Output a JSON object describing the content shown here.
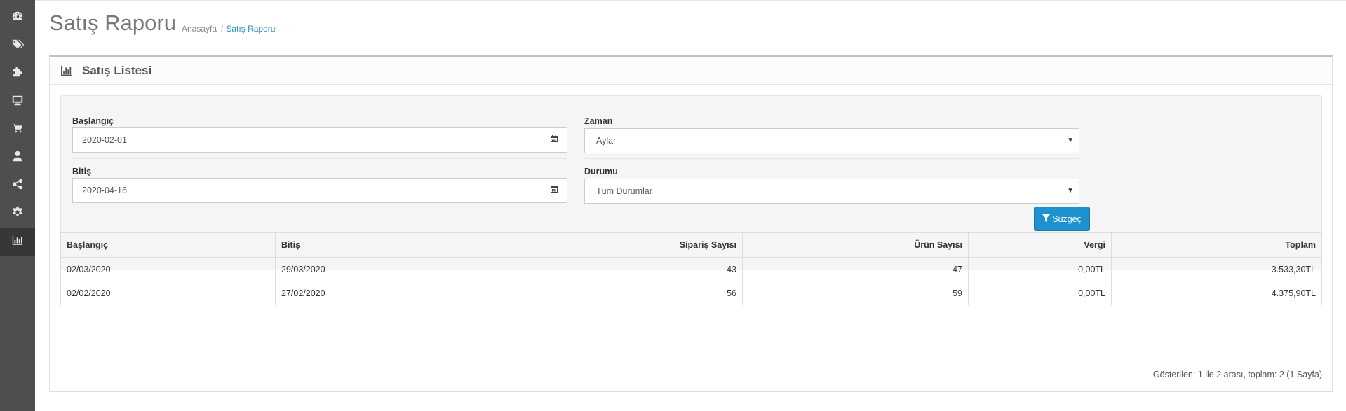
{
  "header": {
    "title": "Satış Raporu",
    "breadcrumb": [
      {
        "label": "Anasayfa"
      },
      {
        "label": "Satış Raporu"
      }
    ],
    "breadcrumb_separator": "/"
  },
  "sidebar": {
    "items": [
      {
        "icon": "dashboard-icon"
      },
      {
        "icon": "tags-icon"
      },
      {
        "icon": "puzzle-icon"
      },
      {
        "icon": "monitor-icon"
      },
      {
        "icon": "cart-icon"
      },
      {
        "icon": "user-icon"
      },
      {
        "icon": "share-icon"
      },
      {
        "icon": "gear-icon"
      },
      {
        "icon": "bar-chart-icon",
        "active": true
      }
    ]
  },
  "panel": {
    "title": "Satış Listesi",
    "icon": "bar-chart-icon"
  },
  "filter": {
    "start_label": "Başlangıç",
    "start_value": "2020-02-01",
    "end_label": "Bitiş",
    "end_value": "2020-04-16",
    "group_label": "Zaman",
    "group_value": "Aylar",
    "status_label": "Durumu",
    "status_value": "Tüm Durumlar",
    "button_label": "Süzgeç"
  },
  "table": {
    "headers": [
      "Başlangıç",
      "Bitiş",
      "Sipariş Sayısı",
      "Ürün Sayısı",
      "Vergi",
      "Toplam"
    ],
    "rows": [
      [
        "02/03/2020",
        "29/03/2020",
        "43",
        "47",
        "0,00TL",
        "3.533,30TL"
      ],
      [
        "02/02/2020",
        "27/02/2020",
        "56",
        "59",
        "0,00TL",
        "4.375,90TL"
      ]
    ]
  },
  "pagination": {
    "text": "Gösterilen: 1 ile 2 arası, toplam: 2 (1 Sayfa)"
  },
  "colors": {
    "sidebar_bg": "#4e4e4e",
    "sidebar_active": "#373737",
    "primary_button": "#1e91cf",
    "breadcrumb_link": "#2d8ac7"
  }
}
